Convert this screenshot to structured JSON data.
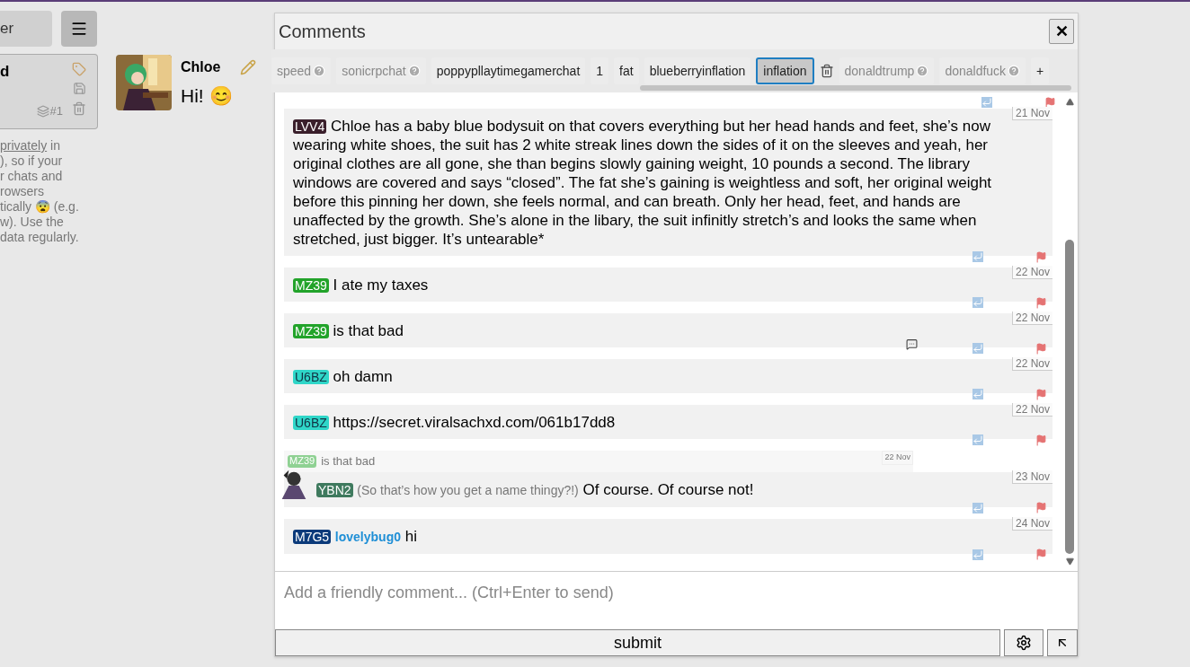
{
  "sidebar": {
    "top_button": "er",
    "card_title": "d",
    "card_count": "#1",
    "note_lines": [
      {
        "link": "privately",
        "text": " in"
      },
      {
        "text": "), so if your"
      },
      {
        "text": "r chats and"
      },
      {
        "text": "rowsers"
      },
      {
        "text": "tically 😨 (e.g."
      },
      {
        "text": "w). Use the"
      },
      {
        "text": "data regularly."
      }
    ]
  },
  "character": {
    "name": "Chloe",
    "greeting": "Hi! 😊"
  },
  "comments": {
    "title": "Comments",
    "close": "✕",
    "tabs": [
      {
        "label": "speed",
        "help": true,
        "selected": false,
        "dim": true
      },
      {
        "label": "sonicrpchat",
        "help": true,
        "selected": false,
        "dim": true
      },
      {
        "label": "poppypllaytimegamerchat",
        "help": false,
        "selected": false,
        "dim": false
      },
      {
        "label": "1",
        "help": false,
        "selected": false,
        "dim": false
      },
      {
        "label": "fat",
        "help": false,
        "selected": false,
        "dim": false
      },
      {
        "label": "blueberryinflation",
        "help": false,
        "selected": false,
        "dim": false
      },
      {
        "label": "inflation",
        "help": false,
        "selected": true,
        "dim": false
      },
      {
        "label": "donaldtrump",
        "help": true,
        "selected": false,
        "dim": true
      },
      {
        "label": "donaldfuck",
        "help": true,
        "selected": false,
        "dim": true
      },
      {
        "label": "+",
        "help": false,
        "selected": false,
        "dim": false
      }
    ],
    "items": [
      {
        "kind": "cut"
      },
      {
        "kind": "comment",
        "tag": "LVV4",
        "color": "#3a1f2b",
        "date": "21 Nov",
        "text": "Chloe has a baby blue bodysuit on that covers everything but her head hands and feet, she’s now wearing white shoes, the suit has 2 white streak lines down the sides of it on the sleeves and yeah, her original clothes are all gone, she than begins slowly gaining weight, 10 pounds a second. The library windows are covered and says “closed”.  The fat she’s gaining is weightless and soft, her original weight before this pinning her down, she feels normal, and can breath. Only her head, feet, and hands are unaffected by the growth. She’s alone in the libary, the suit infinitly stretch’s and looks the same when stretched, just bigger. It’s untearable*"
      },
      {
        "kind": "comment",
        "tag": "MZ39",
        "color": "#22a32a",
        "date": "22 Nov",
        "text": "I ate my taxes"
      },
      {
        "kind": "comment",
        "tag": "MZ39",
        "color": "#22a32a",
        "date": "22 Nov",
        "text": "is that bad",
        "bubble": true
      },
      {
        "kind": "comment",
        "tag": "U6BZ",
        "color": "#2fd6c8",
        "date": "22 Nov",
        "text": "oh damn"
      },
      {
        "kind": "comment",
        "tag": "U6BZ",
        "color": "#2fd6c8",
        "date": "22 Nov",
        "text": "https://secret.viralsachxd.com/061b17dd8"
      },
      {
        "kind": "quote",
        "tag": "MZ39",
        "color": "#8fd193",
        "date": "22 Nov",
        "text": "is that bad"
      },
      {
        "kind": "comment",
        "tag": "YBN2",
        "color": "#3f7a5e",
        "date": "23 Nov",
        "avatar": true,
        "aside": "(So that’s how you get a name thingy?!)",
        "text": "Of course. Of course not!"
      },
      {
        "kind": "comment",
        "tag": "M7G5",
        "color": "#0b3a7a",
        "date": "24 Nov",
        "name": "lovelybug0",
        "text": "hi"
      }
    ],
    "placeholder": "Add a friendly comment... (Ctrl+Enter to send)",
    "submit": "submit"
  }
}
